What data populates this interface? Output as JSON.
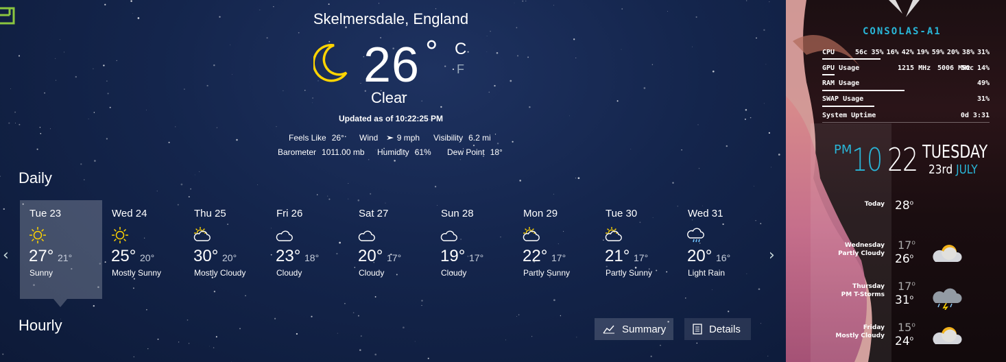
{
  "weather": {
    "location": "Skelmersdale, England",
    "current": {
      "temperature": "26",
      "degree": "°",
      "unit_c": "C",
      "unit_f": "F",
      "condition": "Clear",
      "updated": "Updated as of 10:22:25 PM",
      "icon": "moon-icon"
    },
    "details": {
      "feels_like_label": "Feels Like",
      "feels_like": "26°",
      "wind_label": "Wind",
      "wind": "9 mph",
      "visibility_label": "Visibility",
      "visibility": "6.2 mi",
      "barometer_label": "Barometer",
      "barometer": "1011.00 mb",
      "humidity_label": "Humidity",
      "humidity": "61%",
      "dew_point_label": "Dew Point",
      "dew_point": "18°"
    },
    "daily_title": "Daily",
    "hourly_title": "Hourly",
    "days": [
      {
        "name": "Tue 23",
        "high": "27°",
        "low": "21°",
        "condition": "Sunny",
        "icon": "sun-icon",
        "selected": true
      },
      {
        "name": "Wed 24",
        "high": "25°",
        "low": "20°",
        "condition": "Mostly Sunny",
        "icon": "sun-icon"
      },
      {
        "name": "Thu 25",
        "high": "30°",
        "low": "20°",
        "condition": "Mostly Cloudy",
        "icon": "partly-cloudy-icon"
      },
      {
        "name": "Fri 26",
        "high": "23°",
        "low": "18°",
        "condition": "Cloudy",
        "icon": "cloud-icon"
      },
      {
        "name": "Sat 27",
        "high": "20°",
        "low": "17°",
        "condition": "Cloudy",
        "icon": "cloud-icon"
      },
      {
        "name": "Sun 28",
        "high": "19°",
        "low": "17°",
        "condition": "Cloudy",
        "icon": "cloud-icon"
      },
      {
        "name": "Mon 29",
        "high": "22°",
        "low": "17°",
        "condition": "Partly Sunny",
        "icon": "partly-cloudy-icon"
      },
      {
        "name": "Tue 30",
        "high": "21°",
        "low": "17°",
        "condition": "Partly Sunny",
        "icon": "partly-cloudy-icon"
      },
      {
        "name": "Wed 31",
        "high": "20°",
        "low": "16°",
        "condition": "Light Rain",
        "icon": "rain-cloud-icon"
      }
    ],
    "buttons": {
      "summary": "Summary",
      "details": "Details"
    },
    "colors": {
      "accent": "#ffd400",
      "selected_bg": "rgba(255,255,255,0.22)"
    }
  },
  "rainmeter": {
    "title": "CONSOLAS-A1",
    "cpu": {
      "label": "CPU",
      "temp": "56c",
      "values": [
        "35%",
        "16%",
        "42%",
        "19%",
        "59%",
        "20%",
        "38%",
        "31%"
      ],
      "usage_pct": 35
    },
    "gpu": {
      "label": "GPU Usage",
      "core": "1215 MHz",
      "mem": "5006 MHz",
      "temp": "56c",
      "usage": "14%"
    },
    "ram": {
      "label": "RAM Usage",
      "usage": "49%",
      "usage_pct": 49
    },
    "swap": {
      "label": "SWAP Usage",
      "usage": "31%",
      "usage_pct": 31
    },
    "uptime": {
      "label": "System Uptime",
      "value": "0d 3:31"
    },
    "clock": {
      "ampm": "PM",
      "hour": "10",
      "minute": "22",
      "weekday": "TUESDAY",
      "date": "23rd",
      "month": "JULY"
    },
    "forecast": [
      {
        "day": "Today",
        "cond": "",
        "low": "",
        "high": "28",
        "deg": "o"
      },
      {
        "day": "Wednesday",
        "cond": "Partly Cloudy",
        "low": "17",
        "high": "26",
        "deg": "o"
      },
      {
        "day": "Thursday",
        "cond": "PM T-Storms",
        "low": "17",
        "high": "31",
        "deg": "o"
      },
      {
        "day": "Friday",
        "cond": "Mostly Cloudy",
        "low": "15",
        "high": "24",
        "deg": "o"
      }
    ],
    "colors": {
      "accent": "#29b6d8"
    }
  }
}
